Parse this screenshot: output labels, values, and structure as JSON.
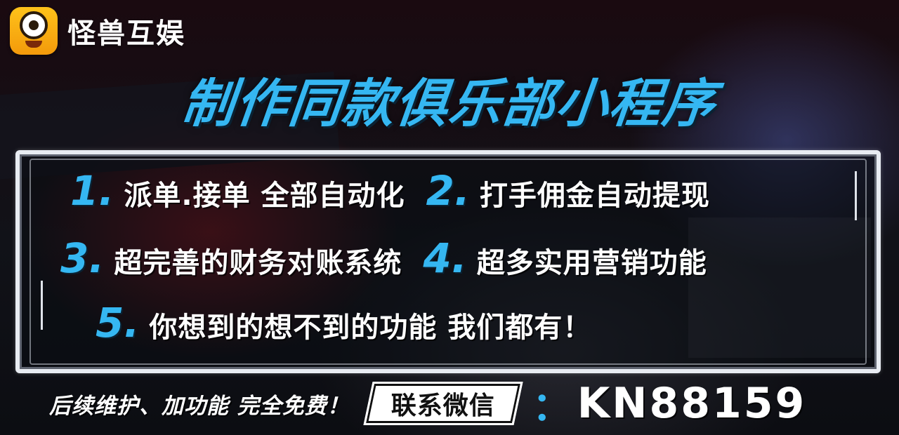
{
  "brand": {
    "name": "怪兽互娱",
    "logo_icon": "monster-eye-logo-icon",
    "logo_color": "#ffc21a"
  },
  "headline": "制作同款俱乐部小程序",
  "colors": {
    "accent": "#35b7f2",
    "text": "#ffffff"
  },
  "features": [
    {
      "num": "1.",
      "text": "派单.接单  全部自动化"
    },
    {
      "num": "2.",
      "text": "打手佣金自动提现"
    },
    {
      "num": "3.",
      "text": "超完善的财务对账系统"
    },
    {
      "num": "4.",
      "text": "超多实用营销功能"
    },
    {
      "num": "5.",
      "text": "你想到的想不到的功能  我们都有！"
    }
  ],
  "footer": {
    "note": "后续维护、加功能 完全免费！",
    "contact_label": "联系微信",
    "colon": "：",
    "wechat_id": "KN88159"
  }
}
